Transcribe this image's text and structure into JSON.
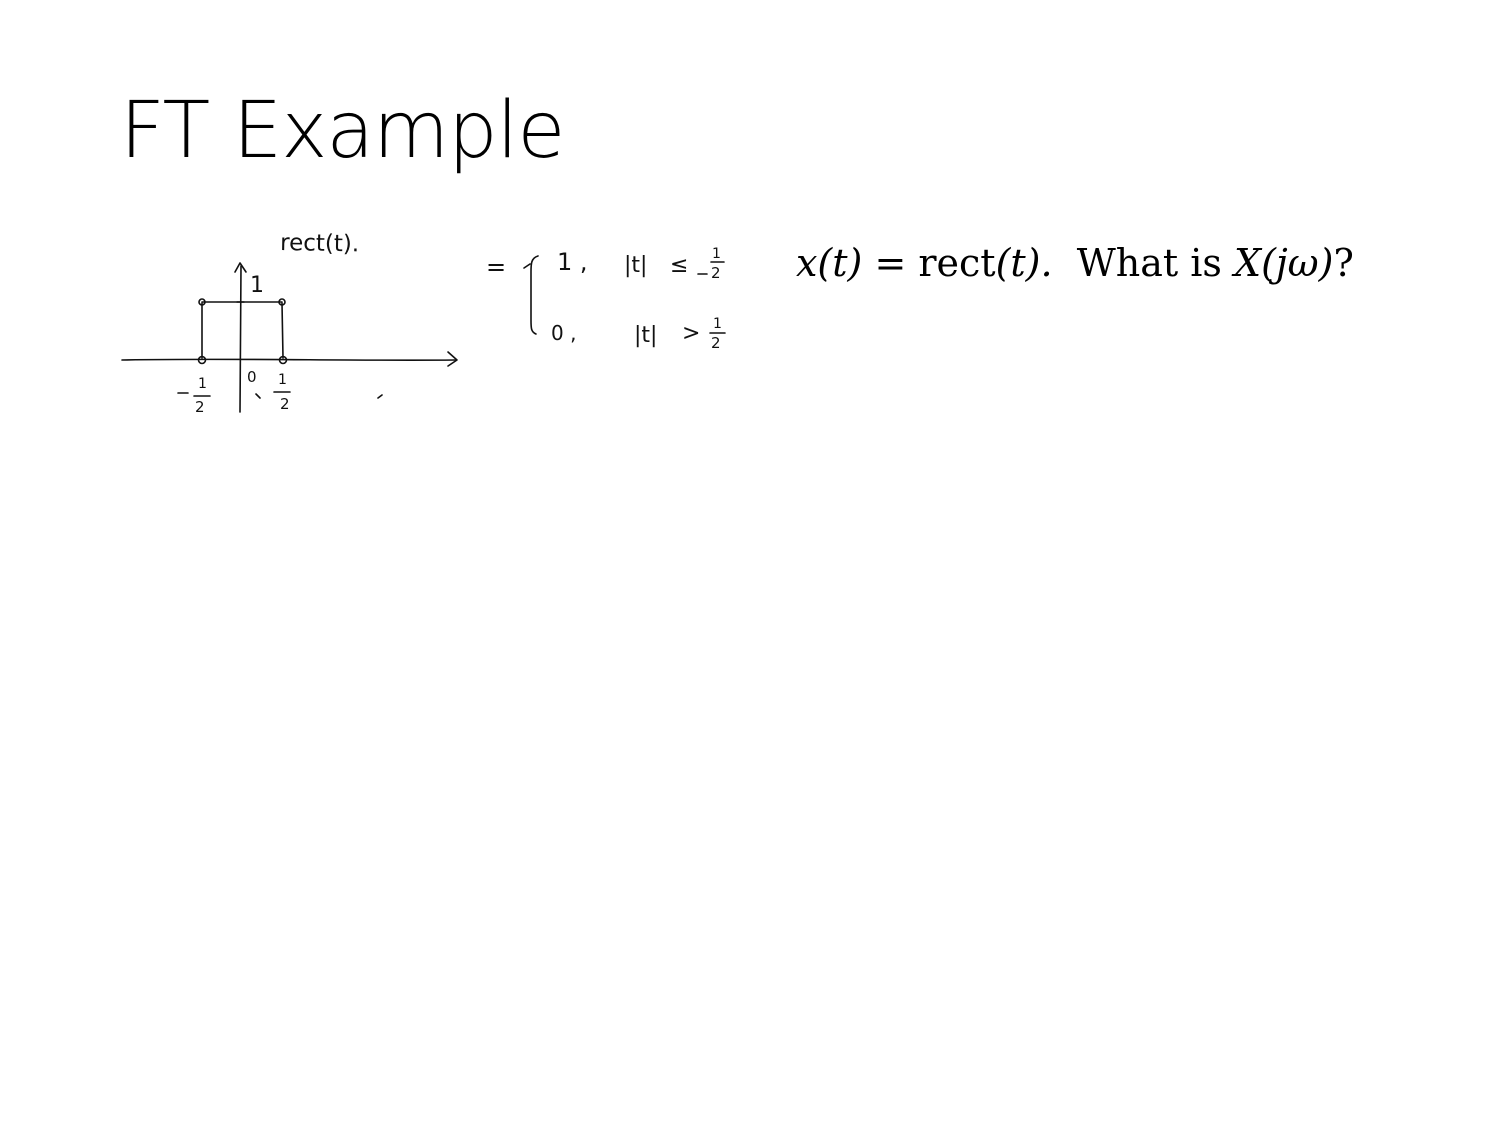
{
  "slide": {
    "title": "FT Example"
  },
  "sketch": {
    "function_label": "rect(t).",
    "height_label": "1",
    "origin_label": "0",
    "left_edge_label": "-1/2",
    "right_edge_label": "1/2",
    "definition": {
      "equals": "=",
      "case1_value": "1 ,",
      "case1_condition": "|t| ≤ 1/2",
      "case2_value": "0 ,",
      "case2_condition": "|t| > 1/2"
    }
  },
  "question": {
    "lhs": "x(t)",
    "eq": " = ",
    "rect": "rect",
    "arg": "(t).",
    "what_is": "  What is ",
    "transform": "X(jω)",
    "qmark": "?"
  }
}
